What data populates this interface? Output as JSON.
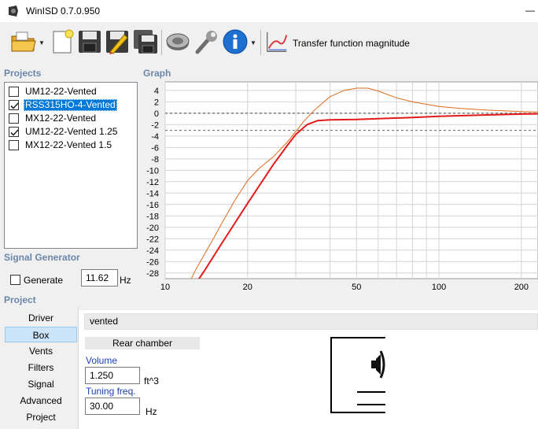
{
  "window": {
    "title": "WinISD 0.7.0.950",
    "minimize_glyph": "—"
  },
  "toolbar": {
    "buttons": [
      {
        "name": "open-folder-icon"
      },
      {
        "name": "new-document-icon"
      },
      {
        "name": "save-icon"
      },
      {
        "name": "edit-icon"
      },
      {
        "name": "save-all-icon"
      },
      {
        "name": "driver-icon"
      },
      {
        "name": "wrench-icon"
      },
      {
        "name": "info-icon"
      },
      {
        "name": "graph-icon"
      }
    ],
    "dropdown_glyph": "▼",
    "graph_type_label": "Transfer function magnitude"
  },
  "projects": {
    "heading": "Projects",
    "items": [
      {
        "label": "UM12-22-Vented",
        "checked": false,
        "selected": false
      },
      {
        "label": "RSS315HO-4-Vented",
        "checked": true,
        "selected": true
      },
      {
        "label": "MX12-22-Vented",
        "checked": false,
        "selected": false
      },
      {
        "label": "UM12-22-Vented 1.25",
        "checked": true,
        "selected": false
      },
      {
        "label": "MX12-22-Vented 1.5",
        "checked": false,
        "selected": false
      }
    ]
  },
  "signal_generator": {
    "heading": "Signal Generator",
    "generate_label": "Generate",
    "generate_checked": false,
    "frequency_value": "11.62",
    "frequency_unit": "Hz"
  },
  "graph": {
    "heading": "Graph"
  },
  "chart_data": {
    "type": "line",
    "xscale": "log",
    "xlim": [
      10,
      230
    ],
    "ylim": [
      -29,
      5.5
    ],
    "x_ticks": [
      10,
      20,
      50,
      100,
      200
    ],
    "x_tick_labels": [
      "10",
      "20",
      "50",
      "100",
      "200"
    ],
    "y_ticks": [
      4,
      2,
      0,
      -2,
      -4,
      -6,
      -8,
      -10,
      -12,
      -14,
      -16,
      -18,
      -20,
      -22,
      -24,
      -26,
      -28
    ],
    "y_tick_labels": [
      "4",
      "2",
      "0",
      "-2",
      "-4",
      "-6",
      "-8",
      "-10",
      "-12",
      "-14",
      "-16",
      "-18",
      "-20",
      "-22",
      "-24",
      "-26",
      "-28"
    ],
    "grid": true,
    "reference_lines": [
      {
        "y": 0,
        "style": "dashed",
        "color": "#444444"
      },
      {
        "y": -3,
        "style": "dashed",
        "color": "#666666"
      }
    ],
    "series": [
      {
        "color": "#e06a1c",
        "width": 1,
        "x": [
          10,
          11,
          12,
          13,
          14,
          15,
          16,
          18,
          20,
          22,
          25,
          28,
          30,
          32,
          35,
          38,
          40,
          45,
          50,
          55,
          60,
          70,
          80,
          100,
          120,
          150,
          200,
          230
        ],
        "y": [
          -37,
          -34,
          -30.5,
          -27.2,
          -24.5,
          -22,
          -19.5,
          -15.2,
          -11.8,
          -9.7,
          -7.5,
          -5,
          -3.2,
          -1.5,
          0.5,
          2,
          2.9,
          4,
          4.4,
          4.4,
          3.9,
          2.7,
          2,
          1.2,
          0.85,
          0.55,
          0.3,
          0.2
        ]
      },
      {
        "color": "#e31a1a",
        "width": 2,
        "x": [
          10,
          12,
          13,
          14,
          16,
          18,
          20,
          22,
          25,
          28,
          30,
          33,
          36,
          40,
          50,
          60,
          80,
          100,
          150,
          200,
          230
        ],
        "y": [
          -40,
          -32,
          -29.7,
          -27.4,
          -23,
          -19.2,
          -15.8,
          -12.8,
          -8.8,
          -5.6,
          -3.7,
          -2.0,
          -1.3,
          -1.15,
          -1.1,
          -0.95,
          -0.75,
          -0.55,
          -0.3,
          -0.15,
          -0.1
        ]
      }
    ]
  },
  "project_panel": {
    "heading": "Project",
    "nav": [
      "Driver",
      "Box",
      "Vents",
      "Filters",
      "Signal",
      "Advanced",
      "Project"
    ],
    "active_nav": "Box"
  },
  "box": {
    "type_value": "vented",
    "rear_chamber_label": "Rear chamber",
    "volume_label": "Volume",
    "volume_value": "1.250",
    "volume_unit": "ft^3",
    "tuning_label": "Tuning freq.",
    "tuning_value": "30.00",
    "tuning_unit": "Hz"
  },
  "colors": {
    "selection": "#0078d7",
    "heading": "#6b86a8",
    "field_label": "#1a3fb0",
    "active_nav_bg": "#cce4f7"
  }
}
